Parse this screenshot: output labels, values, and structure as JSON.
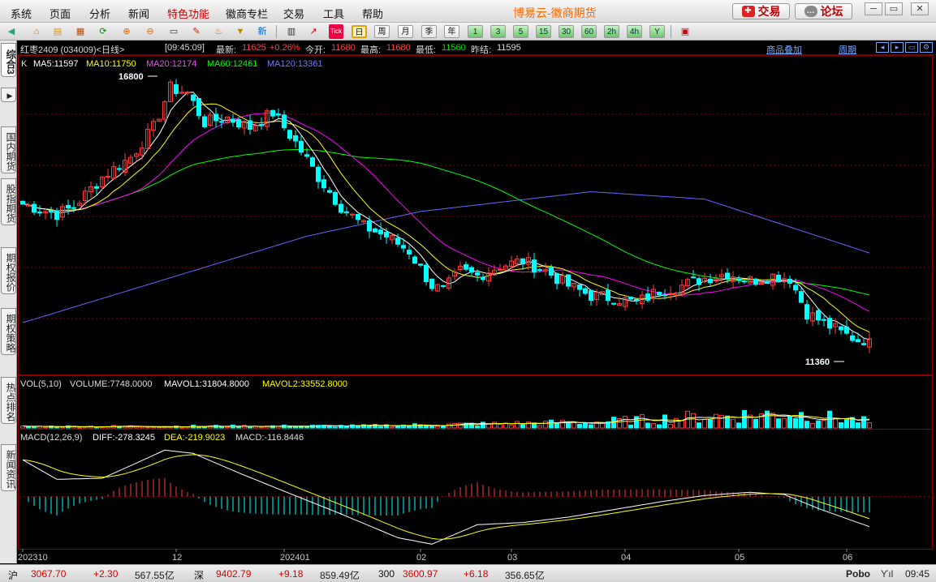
{
  "menu": {
    "items": [
      "系统",
      "页面",
      "分析",
      "新闻",
      "特色功能",
      "徽商专栏",
      "交易",
      "工具",
      "帮助"
    ],
    "highlight": "特色功能",
    "app_title": "博易云-徽商期货",
    "trade_button": "交易",
    "forum_button": "论坛"
  },
  "toolbar": {
    "periods": [
      "日",
      "周",
      "月",
      "季",
      "年",
      "1",
      "3",
      "5",
      "15",
      "30",
      "60",
      "2h",
      "4h",
      "Y"
    ],
    "active_period": "日",
    "tick_label": "Tick",
    "new_label": "新"
  },
  "left_tabs": [
    "综合3",
    "国内期货",
    "股指期货",
    "期权报价",
    "期权策略",
    "热点排名",
    "新闻资讯"
  ],
  "header": {
    "symbol": "红枣2409 (034009)<日线>",
    "time": "[09:45:09]",
    "latest_label": "最新:",
    "latest": "11625",
    "change": "+0.26%",
    "open_label": "今开:",
    "open": "11680",
    "high_label": "最高:",
    "high": "11680",
    "low_label": "最低:",
    "low": "11560",
    "prev_label": "昨结:",
    "prev": "11595",
    "overlay_link": "商品叠加",
    "period_link": "周期"
  },
  "ma_line": {
    "k": "K",
    "ma5": "MA5:11597",
    "ma10": "MA10:11750",
    "ma20": "MA20:12174",
    "ma60": "MA60:12461",
    "ma120": "MA120:13361"
  },
  "volume_line": {
    "title": "VOL(5,10)",
    "volume": "VOLUME:7748.0000",
    "mavol1": "MAVOL1:31804.8000",
    "mavol2": "MAVOL2:33552.8000"
  },
  "macd_line": {
    "title": "MACD(12,26,9)",
    "diff": "DIFF:-278.3245",
    "dea": "DEA:-219.9023",
    "macd": "MACD:-116.8446"
  },
  "colors": {
    "up": "#ff3b3b",
    "down": "#00ffff",
    "ma5": "#ffffff",
    "ma10": "#ffff00",
    "ma20": "#ff00ff",
    "ma60": "#00ff00",
    "ma120": "#6666ff",
    "grid": "#8b0000"
  },
  "chart_data": {
    "type": "candlestick",
    "high_mark": "16800",
    "low_mark": "11360",
    "price_range": [
      11000,
      17200
    ],
    "x_labels": [
      "202310",
      "12",
      "202401",
      "02",
      "03",
      "04",
      "05",
      "06"
    ],
    "x_label_index": [
      0,
      27,
      46,
      70,
      86,
      106,
      126,
      145
    ],
    "count": 150,
    "price_keypoints": [
      [
        0,
        14350
      ],
      [
        6,
        14150
      ],
      [
        9,
        14300
      ],
      [
        14,
        14900
      ],
      [
        19,
        15300
      ],
      [
        23,
        15900
      ],
      [
        26,
        16700
      ],
      [
        29,
        16600
      ],
      [
        32,
        16000
      ],
      [
        36,
        16100
      ],
      [
        40,
        15900
      ],
      [
        44,
        16200
      ],
      [
        48,
        15600
      ],
      [
        52,
        14900
      ],
      [
        56,
        14300
      ],
      [
        60,
        13900
      ],
      [
        64,
        13700
      ],
      [
        68,
        13400
      ],
      [
        72,
        12700
      ],
      [
        74,
        12600
      ],
      [
        77,
        13000
      ],
      [
        80,
        12900
      ],
      [
        84,
        13100
      ],
      [
        88,
        13200
      ],
      [
        92,
        13000
      ],
      [
        96,
        12700
      ],
      [
        100,
        12500
      ],
      [
        104,
        12450
      ],
      [
        108,
        12350
      ],
      [
        112,
        12600
      ],
      [
        116,
        12700
      ],
      [
        120,
        12850
      ],
      [
        124,
        12950
      ],
      [
        128,
        12800
      ],
      [
        132,
        12900
      ],
      [
        135,
        12850
      ],
      [
        138,
        12150
      ],
      [
        141,
        11950
      ],
      [
        144,
        11750
      ],
      [
        147,
        11600
      ],
      [
        149,
        11625
      ]
    ],
    "ma120_keypoints": [
      [
        0,
        11950
      ],
      [
        20,
        12650
      ],
      [
        50,
        13700
      ],
      [
        70,
        14200
      ],
      [
        100,
        14600
      ],
      [
        120,
        14450
      ],
      [
        149,
        13361
      ]
    ],
    "volume_keypoints": [
      [
        0,
        1800
      ],
      [
        60,
        2500
      ],
      [
        100,
        7000
      ],
      [
        120,
        14000
      ],
      [
        135,
        18000
      ],
      [
        149,
        7748
      ]
    ],
    "volume_range": [
      0,
      60000
    ],
    "macd_range": [
      -460,
      500
    ],
    "diff_keypoints": [
      [
        0,
        340
      ],
      [
        6,
        160
      ],
      [
        14,
        170
      ],
      [
        20,
        310
      ],
      [
        25,
        430
      ],
      [
        30,
        400
      ],
      [
        38,
        220
      ],
      [
        46,
        50
      ],
      [
        56,
        -160
      ],
      [
        66,
        -380
      ],
      [
        72,
        -440
      ],
      [
        80,
        -260
      ],
      [
        88,
        -240
      ],
      [
        96,
        -190
      ],
      [
        104,
        -120
      ],
      [
        112,
        -50
      ],
      [
        120,
        10
      ],
      [
        128,
        40
      ],
      [
        134,
        20
      ],
      [
        140,
        -110
      ],
      [
        149,
        -278
      ]
    ]
  },
  "status": {
    "sh_label": "沪",
    "sh_value": "3067.70",
    "sh_change": "+2.30",
    "sh_amount": "567.55亿",
    "sz_label": "深",
    "sz_value": "9402.79",
    "sz_change": "+9.18",
    "sz_amount": "859.49亿",
    "i300_label": "300",
    "i300_value": "3600.97",
    "i300_change": "+6.18",
    "i300_amount": "356.65亿",
    "brand": "Pobo",
    "clock": "09:45"
  }
}
